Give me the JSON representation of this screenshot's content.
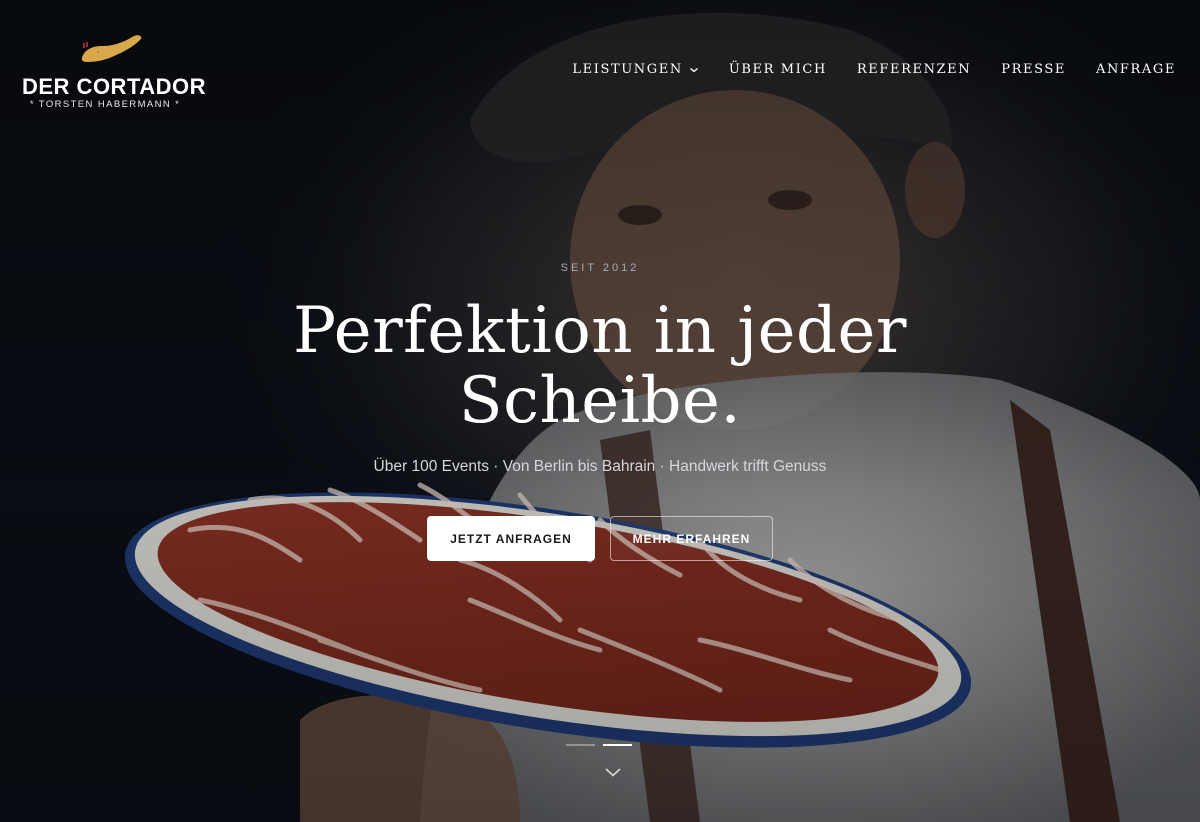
{
  "brand": {
    "name": "DER CORTADOR",
    "subtitle": "TORSTEN HABERMANN",
    "star": "*",
    "accent_color": "#d9a84a"
  },
  "nav": {
    "items": [
      {
        "label": "LEISTUNGEN",
        "has_dropdown": true
      },
      {
        "label": "ÜBER MICH"
      },
      {
        "label": "REFERENZEN"
      },
      {
        "label": "PRESSE"
      },
      {
        "label": "ANFRAGE"
      }
    ]
  },
  "hero": {
    "eyebrow": "SEIT 2012",
    "headline_line1": "Perfektion in jeder",
    "headline_line2": "Scheibe.",
    "tagline": "Über 100 Events · Von Berlin bis Bahrain · Handwerk trifft Genuss",
    "primary_button": "JETZT ANFRAGEN",
    "secondary_button": "MEHR ERFAHREN",
    "slides_total": 2,
    "active_slide": 2
  },
  "icons": {
    "logo": "ham-leg-icon",
    "dropdown": "chevron-down-icon",
    "scroll": "chevron-down-icon"
  },
  "colors": {
    "background": "#0b0f16",
    "text": "#ffffff",
    "ham": "#9a3a2c",
    "plate_rim": "#2d4f8e"
  }
}
